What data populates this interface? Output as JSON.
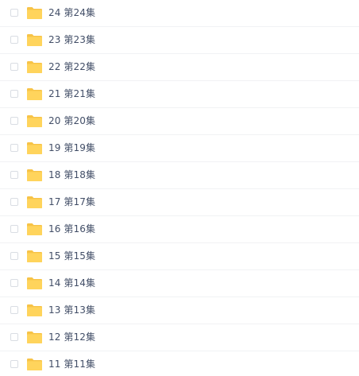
{
  "folder_icon": {
    "name": "folder-icon",
    "fill": "#ffd45c",
    "tab": "#f7c347"
  },
  "files": [
    {
      "number": "24",
      "title": "第24集"
    },
    {
      "number": "23",
      "title": "第23集"
    },
    {
      "number": "22",
      "title": "第22集"
    },
    {
      "number": "21",
      "title": "第21集"
    },
    {
      "number": "20",
      "title": "第20集"
    },
    {
      "number": "19",
      "title": "第19集"
    },
    {
      "number": "18",
      "title": "第18集"
    },
    {
      "number": "17",
      "title": "第17集"
    },
    {
      "number": "16",
      "title": "第16集"
    },
    {
      "number": "15",
      "title": "第15集"
    },
    {
      "number": "14",
      "title": "第14集"
    },
    {
      "number": "13",
      "title": "第13集"
    },
    {
      "number": "12",
      "title": "第12集"
    },
    {
      "number": "11",
      "title": "第11集"
    }
  ]
}
